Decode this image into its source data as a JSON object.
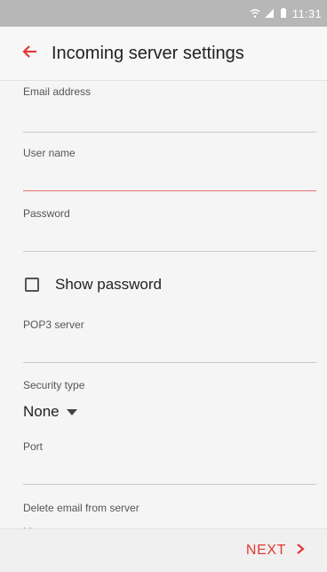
{
  "status_bar": {
    "time": "11:31"
  },
  "app_bar": {
    "title": "Incoming server settings",
    "back_icon": "arrow-left-icon"
  },
  "form": {
    "email_label": "Email address",
    "email_value": "",
    "username_label": "User name",
    "username_value": "",
    "password_label": "Password",
    "password_value": "",
    "show_password_label": "Show password",
    "show_password_checked": false,
    "pop3_label": "POP3 server",
    "pop3_value": "",
    "security_label": "Security type",
    "security_value": "None",
    "port_label": "Port",
    "port_value": "",
    "delete_label": "Delete email from server"
  },
  "footer": {
    "next_label": "NEXT",
    "next_icon": "chevron-right-icon"
  },
  "colors": {
    "accent": "#e53935",
    "status_bar": "#b7b7b7",
    "background": "#f5f5f5"
  }
}
